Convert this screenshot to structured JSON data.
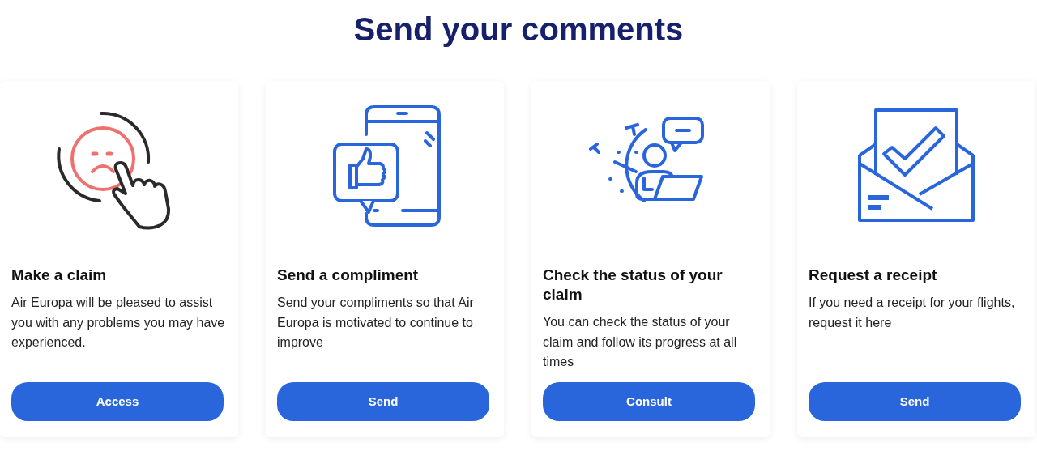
{
  "heading": "Send your comments",
  "cards": [
    {
      "title": "Make a claim",
      "description": "Air Europa will be pleased to assist you with any problems you may have experienced.",
      "button": "Access"
    },
    {
      "title": "Send a compliment",
      "description": "Send your compliments so that Air Europa is motivated to continue to improve",
      "button": "Send"
    },
    {
      "title": "Check the status of your claim",
      "description": "You can check the status of your claim and follow its progress at all times",
      "button": "Consult"
    },
    {
      "title": "Request a receipt",
      "description": "If you need a receipt for your flights, request it here",
      "button": "Send"
    }
  ]
}
